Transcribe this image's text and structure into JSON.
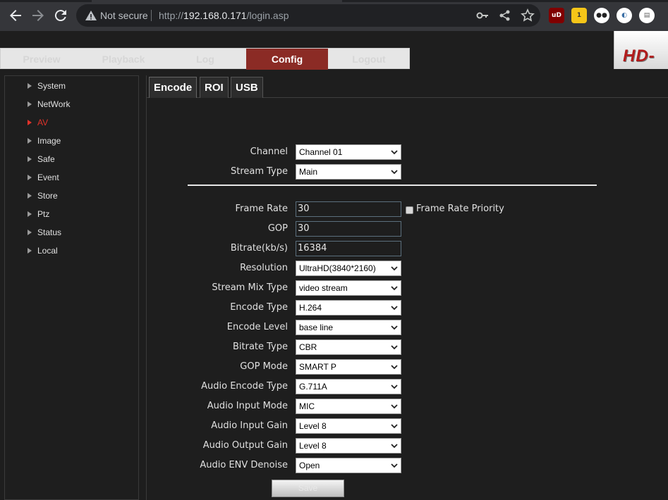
{
  "browser": {
    "not_secure": "Not secure",
    "url_scheme": "http://",
    "url_host": "192.168.0.171",
    "url_path": "/login.asp",
    "icons": [
      "back-icon",
      "forward-icon",
      "reload-icon",
      "warning-icon",
      "key-icon",
      "share-icon",
      "star-icon"
    ],
    "extensions": [
      {
        "name": "ublock",
        "label": "uD",
        "color": "#800000"
      },
      {
        "name": "notes",
        "label": "1",
        "color": "#f5c518"
      },
      {
        "name": "ghostery",
        "label": "●●",
        "color": "#ffffff"
      },
      {
        "name": "tracker",
        "label": "◐",
        "color": "#ffffff"
      },
      {
        "name": "document",
        "label": "▤",
        "color": "#ffffff"
      }
    ]
  },
  "topnav": {
    "tabs": [
      "Preview",
      "Playback",
      "Log",
      "Config",
      "Logout"
    ],
    "active": "Config",
    "logo_text": "HD-"
  },
  "sidebar": {
    "items": [
      "System",
      "NetWork",
      "AV",
      "Image",
      "Safe",
      "Event",
      "Store",
      "Ptz",
      "Status",
      "Local"
    ],
    "active": "AV"
  },
  "subtabs": [
    "Encode",
    "ROI",
    "USB"
  ],
  "form": {
    "channel": {
      "label": "Channel",
      "value": "Channel 01"
    },
    "stream_type": {
      "label": "Stream Type",
      "value": "Main"
    },
    "frame_rate": {
      "label": "Frame Rate",
      "value": "30"
    },
    "frame_rate_priority": "Frame Rate Priority",
    "gop": {
      "label": "GOP",
      "value": "30"
    },
    "bitrate": {
      "label": "Bitrate(kb/s)",
      "value": "16384"
    },
    "resolution": {
      "label": "Resolution",
      "value": "UltraHD(3840*2160)"
    },
    "stream_mix_type": {
      "label": "Stream Mix Type",
      "value": "video stream"
    },
    "encode_type": {
      "label": "Encode Type",
      "value": "H.264"
    },
    "encode_level": {
      "label": "Encode Level",
      "value": "base line"
    },
    "bitrate_type": {
      "label": "Bitrate Type",
      "value": "CBR"
    },
    "gop_mode": {
      "label": "GOP Mode",
      "value": "SMART P"
    },
    "audio_encode_type": {
      "label": "Audio Encode Type",
      "value": "G.711A"
    },
    "audio_input_mode": {
      "label": "Audio Input Mode",
      "value": "MIC"
    },
    "audio_input_gain": {
      "label": "Audio Input Gain",
      "value": "Level 8"
    },
    "audio_output_gain": {
      "label": "Audio Output Gain",
      "value": "Level 8"
    },
    "audio_env_denoise": {
      "label": "Audio ENV Denoise",
      "value": "Open"
    },
    "save": "Save"
  },
  "colors": {
    "active_tab": "#8b2b25",
    "active_sidebar": "#e0322a",
    "logo": "#b21c1c"
  }
}
